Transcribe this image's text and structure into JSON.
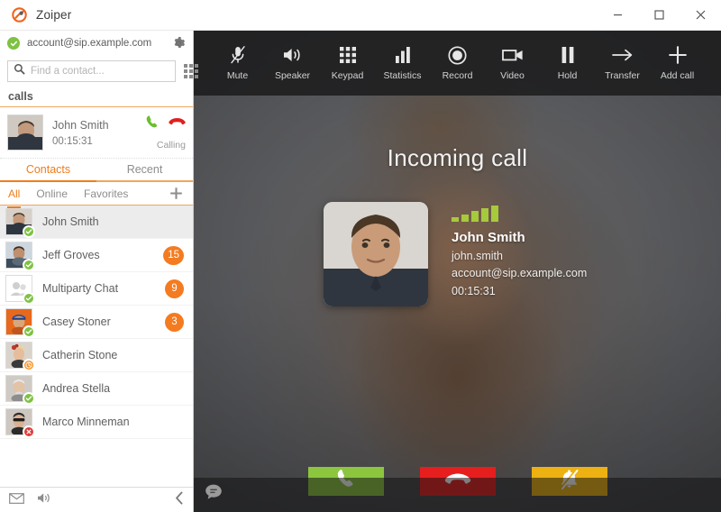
{
  "window": {
    "title": "Zoiper",
    "logo_icon": "zoiper-logo-icon",
    "minimize_label": "Minimize",
    "maximize_label": "Maximize",
    "close_label": "Close"
  },
  "sidebar": {
    "account": {
      "status_icon": "online-check-icon",
      "name": "account@sip.example.com",
      "settings_icon": "gear-icon"
    },
    "search": {
      "icon": "search-icon",
      "placeholder": "Find a contact...",
      "value": "",
      "dialpad_icon": "dialpad-grid-icon"
    },
    "calls_label": "calls",
    "active_call": {
      "name": "John Smith",
      "duration": "00:15:31",
      "status": "Calling",
      "answer_icon": "phone-answer-icon",
      "hangup_icon": "phone-hangup-icon",
      "avatar_icon": "contact-avatar"
    },
    "main_tabs": [
      {
        "label": "Contacts",
        "active": true
      },
      {
        "label": "Recent",
        "active": false
      }
    ],
    "sub_tabs": [
      {
        "label": "All",
        "active": true
      },
      {
        "label": "Online",
        "active": false
      },
      {
        "label": "Favorites",
        "active": false
      }
    ],
    "add_contact_icon": "plus-icon",
    "contacts": [
      {
        "name": "John Smith",
        "status": "online",
        "badge": "",
        "selected": true,
        "avatar": "photo"
      },
      {
        "name": "Jeff Groves",
        "status": "online",
        "badge": "15",
        "selected": false,
        "avatar": "photo"
      },
      {
        "name": "Multiparty Chat",
        "status": "online",
        "badge": "9",
        "selected": false,
        "avatar": "group"
      },
      {
        "name": "Casey Stoner",
        "status": "online",
        "badge": "3",
        "selected": false,
        "avatar": "photo"
      },
      {
        "name": "Catherin Stone",
        "status": "away",
        "badge": "",
        "selected": false,
        "avatar": "photo"
      },
      {
        "name": "Andrea Stella",
        "status": "online",
        "badge": "",
        "selected": false,
        "avatar": "photo"
      },
      {
        "name": "Marco Minneman",
        "status": "busy",
        "badge": "",
        "selected": false,
        "avatar": "photo"
      }
    ],
    "footer": {
      "voicemail_icon": "envelope-icon",
      "volume_icon": "speaker-icon",
      "collapse_icon": "chevron-left-icon"
    }
  },
  "call_panel": {
    "toolbar": [
      {
        "label": "Mute",
        "icon": "microphone-muted-icon"
      },
      {
        "label": "Speaker",
        "icon": "speaker-icon"
      },
      {
        "label": "Keypad",
        "icon": "dialpad-grid-icon"
      },
      {
        "label": "Statistics",
        "icon": "bar-chart-icon"
      },
      {
        "label": "Record",
        "icon": "record-circle-icon"
      },
      {
        "label": "Video",
        "icon": "video-camera-icon"
      },
      {
        "label": "Hold",
        "icon": "pause-icon"
      },
      {
        "label": "Transfer",
        "icon": "arrow-right-icon"
      },
      {
        "label": "Add call",
        "icon": "plus-icon"
      }
    ],
    "title": "Incoming call",
    "peer": {
      "name": "John Smith",
      "username": "john.smith",
      "account": "account@sip.example.com",
      "duration": "00:15:31",
      "signal_bars": 5,
      "signal_color": "#a7c93c",
      "avatar_icon": "contact-photo"
    },
    "actions": [
      {
        "name": "answer",
        "icon": "phone-answer-icon",
        "color": "#8cc63e"
      },
      {
        "name": "reject",
        "icon": "phone-hangup-icon",
        "color": "#e61e1e"
      },
      {
        "name": "silence",
        "icon": "bell-muted-icon",
        "color": "#edb211"
      }
    ],
    "chat_icon": "chat-bubble-icon"
  }
}
